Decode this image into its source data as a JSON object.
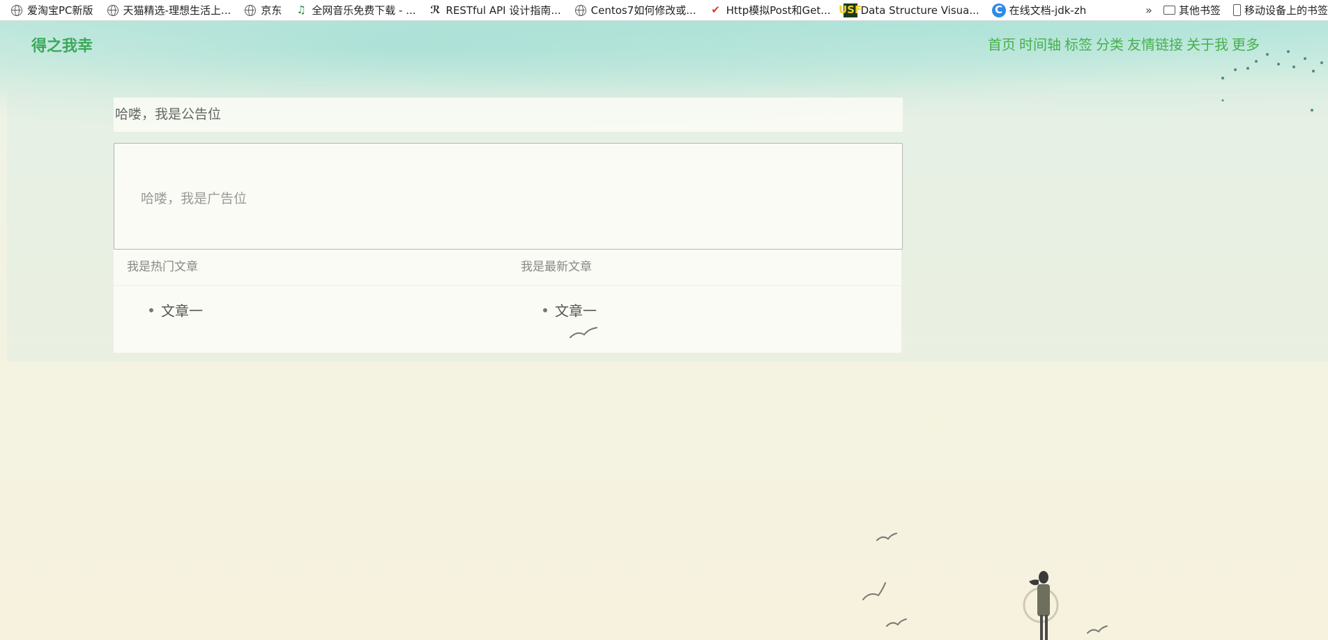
{
  "bookmarks": {
    "items": [
      {
        "label": "爱淘宝PC新版",
        "icon": "globe-icon"
      },
      {
        "label": "天猫精选-理想生活上...",
        "icon": "globe-icon"
      },
      {
        "label": "京东",
        "icon": "globe-icon"
      },
      {
        "label": "全网音乐免费下载 - ...",
        "icon": "music-icon",
        "glyph": "♫"
      },
      {
        "label": "RESTful API 设计指南...",
        "icon": "rest-logo-icon",
        "glyph": "ℛ"
      },
      {
        "label": "Centos7如何修改或...",
        "icon": "globe-icon"
      },
      {
        "label": "Http模拟Post和Get...",
        "icon": "checkmark-icon",
        "glyph": "✔"
      },
      {
        "label": "Data Structure Visua...",
        "icon": "usf-logo-icon",
        "glyph": "USF"
      },
      {
        "label": "在线文档-jdk-zh",
        "icon": "doc-logo-icon",
        "glyph": "C"
      }
    ],
    "more_glyph": "»",
    "other_label": "其他书签",
    "mobile_label": "移动设备上的书签"
  },
  "header": {
    "logo": "得之我幸",
    "nav": [
      "首页",
      "时间轴",
      "标签",
      "分类",
      "友情链接",
      "关于我",
      "更多"
    ]
  },
  "notice": {
    "text": "哈喽，我是公告位"
  },
  "ad": {
    "text": "哈喽，我是广告位"
  },
  "articles": {
    "hot": {
      "title": "我是热门文章",
      "items": [
        "文章一"
      ]
    },
    "latest": {
      "title": "我是最新文章",
      "items": [
        "文章一"
      ]
    }
  },
  "colors": {
    "logo": "#3aa85a",
    "nav": "#47b04b",
    "background_top": "#b9e6dc",
    "background_bottom": "#f6f2de"
  }
}
